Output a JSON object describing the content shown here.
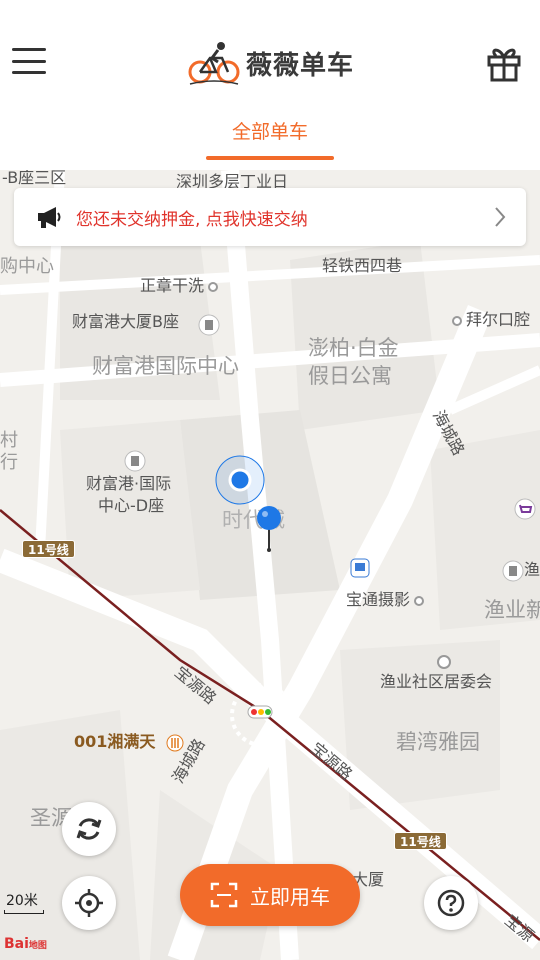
{
  "header": {
    "app_name": "薇薇单车",
    "icons": {
      "menu": "hamburger-menu-icon",
      "logo": "cyclist-logo-icon",
      "gift": "gift-icon"
    }
  },
  "tabs": [
    {
      "label": "全部单车",
      "active": true
    }
  ],
  "notice": {
    "text": "您还未交纳押金, 点我快速交纳",
    "color": "#e0342c",
    "icon": "megaphone-icon"
  },
  "map": {
    "labels": {
      "tl_cut": "-B座三区",
      "top_cut": "深圳多层丁业日",
      "left_center": "购中心",
      "light_rail": "轻铁西四巷",
      "zhengzhang": "正章干洗",
      "caifu_b": "财富港大厦B座",
      "bair": "拜尔口腔",
      "caifu_intl": "财富港国际中心",
      "pengbai_1": "澎柏·白金",
      "pengbai_2": "假日公寓",
      "haicheng_road_1": "海城路",
      "village_1": "村",
      "village_2": "行",
      "caifu_d_1": "财富港·国际",
      "caifu_d_2": "中心-D座",
      "shidai": "时代城",
      "baotong": "宝通摄影",
      "yuye_cut": "渔业新",
      "yuye_right": "渔",
      "yuye_committee": "渔业社区居委会",
      "baoyuan_1": "宝源路",
      "baoyuan_2": "宝源路",
      "bituan": "碧湾雅园",
      "xiangmantian": "001湘满天",
      "haicheng_road_2": "海城路",
      "shengyuan": "圣源庭",
      "dasha": "大厦",
      "bottom_road_cut": "宝源",
      "bottom_left_cut": "宝源"
    },
    "line_badges": [
      "11号线",
      "11号线"
    ],
    "scale_text": "20米",
    "attribution": "Bai",
    "attribution_small": "地图"
  },
  "controls": {
    "use_bike_label": "立即用车",
    "refresh_icon": "refresh-icon",
    "locate_icon": "locate-crosshair-icon",
    "help_icon": "help-question-icon",
    "scan_icon": "scan-frame-icon"
  },
  "colors": {
    "accent": "#f26b2a",
    "notice_text": "#e0342c",
    "map_bg": "#f2f0ec",
    "metro_line": "#7a2020",
    "location_blue": "#1e78e6"
  }
}
